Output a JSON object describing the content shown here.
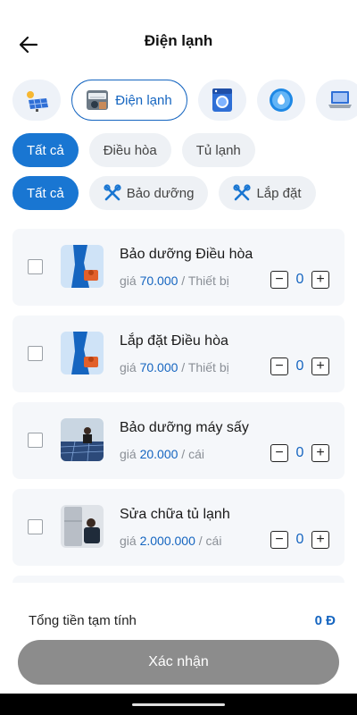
{
  "header": {
    "title": "Điện lạnh",
    "back_icon": "arrow-left-icon"
  },
  "categories": [
    {
      "icon": "solar-panel-icon",
      "label": "",
      "active": false
    },
    {
      "icon": "air-conditioner-thumb",
      "label": "Điện lạnh",
      "active": true
    },
    {
      "icon": "washing-machine-icon",
      "label": "",
      "active": false
    },
    {
      "icon": "water-drop-icon",
      "label": "",
      "active": false
    },
    {
      "icon": "laptop-icon",
      "label": "",
      "active": false
    }
  ],
  "filters_type": {
    "items": [
      "Tất cả",
      "Điều hòa",
      "Tủ lạnh"
    ],
    "active_index": 0
  },
  "filters_service": {
    "items": [
      "Tất cả",
      "Bảo dưỡng",
      "Lắp đặt"
    ],
    "active_index": 0
  },
  "services": [
    {
      "name": "Bảo dưỡng Điều hòa",
      "price_prefix": "giá",
      "price": "70.000",
      "unit": "/ Thiết bị",
      "qty": "0",
      "image": "ac-technician"
    },
    {
      "name": "Lắp đặt Điều hòa",
      "price_prefix": "giá",
      "price": "70.000",
      "unit": "/ Thiết bị",
      "qty": "0",
      "image": "ac-technician"
    },
    {
      "name": "Bảo dưỡng máy sấy",
      "price_prefix": "giá",
      "price": "20.000",
      "unit": "/ cái",
      "qty": "0",
      "image": "solar-roof-photo"
    },
    {
      "name": "Sửa chữa tủ lạnh",
      "price_prefix": "giá",
      "price": "2.000.000",
      "unit": "/ cái",
      "qty": "0",
      "image": "fridge-repair-photo"
    }
  ],
  "footer": {
    "total_label": "Tổng tiền tạm tính",
    "total_value": "0 Đ",
    "confirm_label": "Xác nhận"
  },
  "colors": {
    "primary": "#1976d2",
    "chip_bg": "#eef1f5",
    "card_bg": "#f5f7fa",
    "confirm_disabled": "#8c8c8c"
  }
}
